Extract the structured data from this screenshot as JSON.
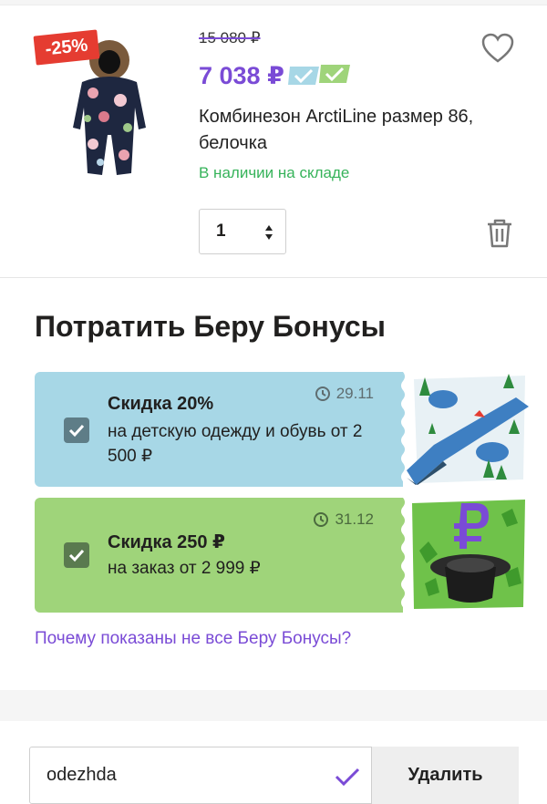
{
  "product": {
    "discount_badge": "-25%",
    "old_price": "15 080 ₽",
    "new_price": "7 038 ₽",
    "title": "Комбинезон ArctiLine размер 86, белочка",
    "stock_status": "В наличии на складе",
    "quantity": "1",
    "icons": {
      "favorite": "heart-icon",
      "delete": "trash-icon",
      "quantity_arrows": "up-down-arrows-icon",
      "price_marks": "check-badges-icon"
    },
    "colors": {
      "price": "#7a4bd6",
      "badge": "#e53c31",
      "stock": "#36b35a"
    }
  },
  "bonuses": {
    "title": "Потратить Беру Бонусы",
    "items": [
      {
        "heading": "Скидка 20%",
        "body": "на детскую одежду и обувь от 2 500 ₽",
        "date": "29.11",
        "checked": true,
        "color": "#a7d7e6"
      },
      {
        "heading": "Скидка 250 ₽",
        "body": "на заказ от 2 999 ₽",
        "date": "31.12",
        "checked": true,
        "color": "#9fd47a"
      }
    ],
    "why_link": "Почему показаны не все Беру Бонусы?"
  },
  "promo": {
    "value": "odezhda",
    "delete_label": "Удалить"
  }
}
